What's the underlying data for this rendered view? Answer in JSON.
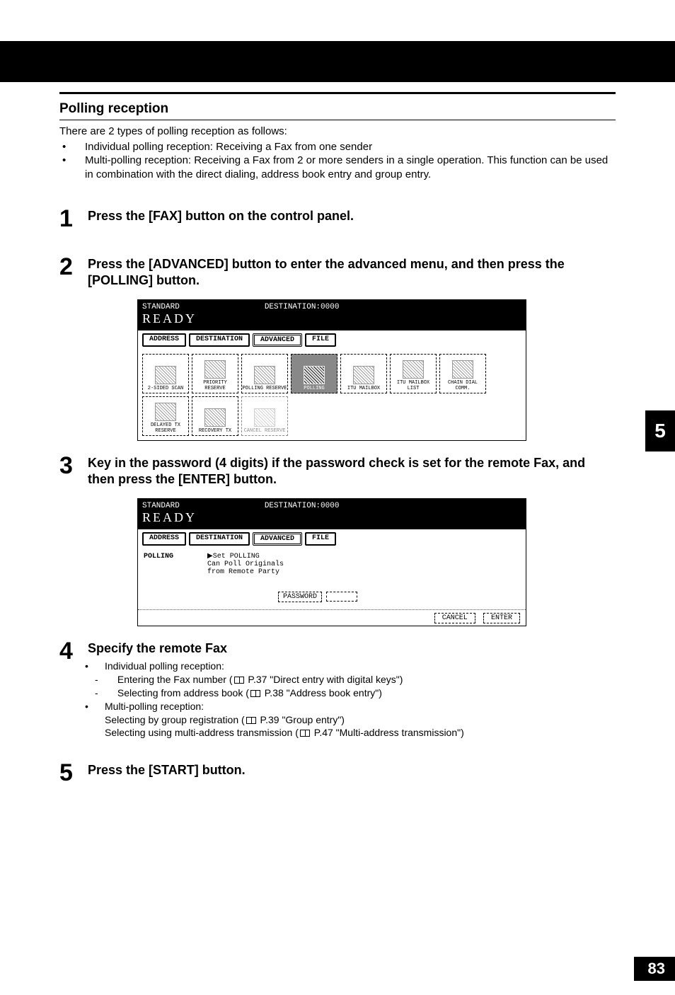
{
  "top_band": "",
  "heading": "Polling reception",
  "intro": "There are 2 types of polling reception as follows:",
  "intro_bullets": [
    "Individual polling reception: Receiving a Fax from one sender",
    "Multi-polling reception: Receiving a Fax from 2 or more senders in a single operation. This function can be used in combination with the direct dialing, address book entry and group entry."
  ],
  "steps": {
    "s1": {
      "num": "1",
      "title": "Press the [FAX] button on the control panel."
    },
    "s2": {
      "num": "2",
      "title": "Press the [ADVANCED] button to enter the advanced menu, and then press the [POLLING] button."
    },
    "s3": {
      "num": "3",
      "title": "Key in the password (4 digits) if the password check is set for the remote Fax, and then press the [ENTER] button."
    },
    "s4": {
      "num": "4",
      "title": "Specify the remote Fax",
      "b1": "Individual polling reception:",
      "d1a": "Entering the Fax number (",
      "d1b": " P.37 \"Direct entry with digital keys\")",
      "d2a": "Selecting from address book (",
      "d2b": " P.38 \"Address book entry\")",
      "b2": "Multi-polling reception:",
      "p1a": "Selecting by group registration (",
      "p1b": " P.39 \"Group entry\")",
      "p2a": "Selecting using multi-address transmission (",
      "p2b": " P.47 \"Multi-address transmission\")"
    },
    "s5": {
      "num": "5",
      "title": "Press the [START] button."
    }
  },
  "lcd1": {
    "mode": "STANDARD",
    "dest": "DESTINATION:0000",
    "ready": "READY",
    "tabs": {
      "t1": "ADDRESS",
      "t2": "DESTINATION",
      "t3": "ADVANCED",
      "t4": "FILE"
    },
    "buttons": {
      "b1": "2-SIDED SCAN",
      "b2": "PRIORITY RESERVE",
      "b3": "POLLING RESERVE",
      "b4": "POLLING",
      "b5": "ITU MAILBOX",
      "b6": "ITU MAILBOX LIST",
      "b7": "CHAIN DIAL COMM.",
      "b8": "DELAYED TX RESERVE",
      "b9": "RECOVERY TX",
      "b10": "CANCEL RESERVE"
    }
  },
  "lcd2": {
    "mode": "STANDARD",
    "dest": "DESTINATION:0000",
    "ready": "READY",
    "tabs": {
      "t1": "ADDRESS",
      "t2": "DESTINATION",
      "t3": "ADVANCED",
      "t4": "FILE"
    },
    "left": "POLLING",
    "line1": "▶Set POLLING",
    "line2": "Can Poll Originals",
    "line3": "from Remote Party",
    "pw_label": "PASSWORD",
    "cancel": "CANCEL",
    "enter": "ENTER"
  },
  "chapter_tab": "5",
  "page_number": "83"
}
